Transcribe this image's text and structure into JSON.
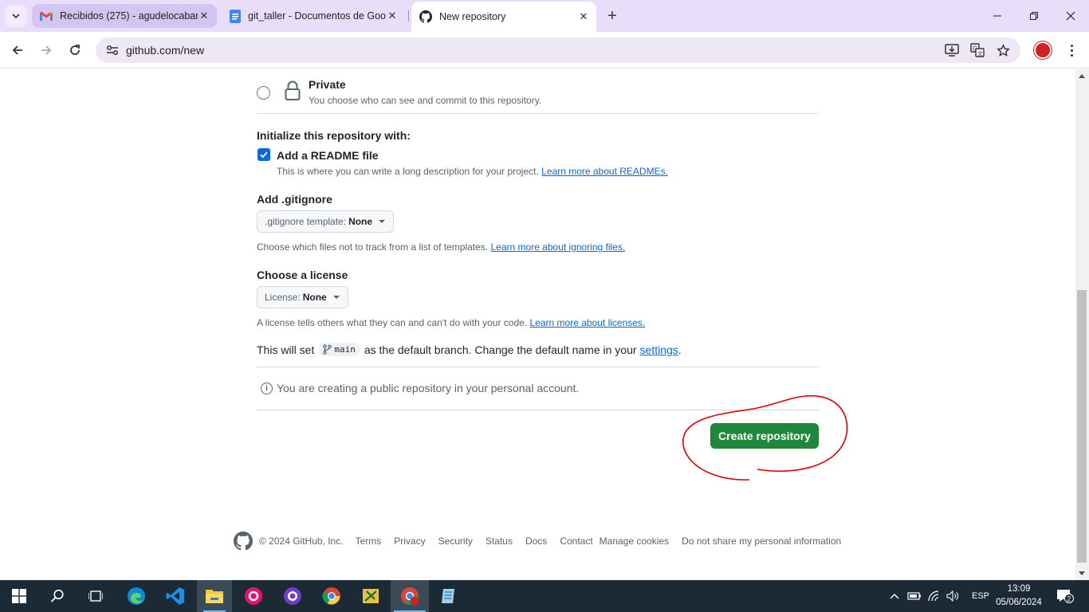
{
  "browser": {
    "tabs": [
      {
        "title": "Recibidos (275) - agudelocaban",
        "icon": "gmail-icon"
      },
      {
        "title": "git_taller - Documentos de Goo",
        "icon": "google-docs-icon"
      },
      {
        "title": "New repository",
        "icon": "github-icon"
      }
    ],
    "url": "github.com/new"
  },
  "form": {
    "private": {
      "title": "Private",
      "description": "You choose who can see and commit to this repository."
    },
    "init_label": "Initialize this repository with:",
    "readme": {
      "label": "Add a README file",
      "checked": true,
      "help": "This is where you can write a long description for your project.",
      "link": "Learn more about READMEs."
    },
    "gitignore": {
      "label": "Add .gitignore",
      "select_prefix": ".gitignore template:",
      "select_value": "None",
      "help": "Choose which files not to track from a list of templates.",
      "link": "Learn more about ignoring files."
    },
    "license": {
      "label": "Choose a license",
      "select_prefix": "License:",
      "select_value": "None",
      "help": "A license tells others what they can and can't do with your code.",
      "link": "Learn more about licenses."
    },
    "branch": {
      "prefix": "This will set",
      "name": "main",
      "middle": "as the default branch. Change the default name in your",
      "link": "settings",
      "suffix": "."
    },
    "info": "You are creating a public repository in your personal account.",
    "submit": "Create repository",
    "submit_color": "#1f883d"
  },
  "footer": {
    "copyright": "© 2024 GitHub, Inc.",
    "links": [
      "Terms",
      "Privacy",
      "Security",
      "Status",
      "Docs",
      "Contact",
      "Manage cookies",
      "Do not share my personal information"
    ]
  },
  "taskbar": {
    "language": "ESP",
    "time": "13:09",
    "date": "05/06/2024",
    "notifications": "2"
  }
}
